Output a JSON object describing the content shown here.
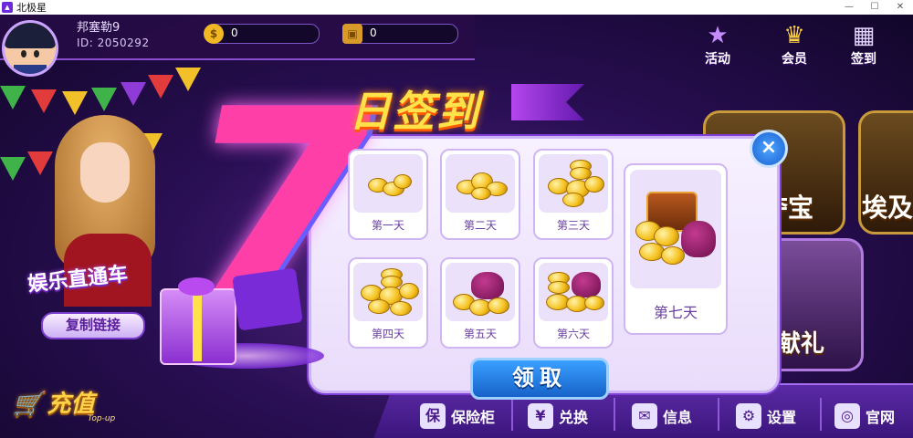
{
  "window": {
    "title": "北极星",
    "app_icon": "app-logo-icon",
    "controls": [
      "minimize-icon",
      "maximize-icon",
      "close-icon"
    ]
  },
  "user": {
    "name": "邦塞勒9",
    "id_text": "ID: 2050292",
    "gold": "0",
    "tickets": "0"
  },
  "top_actions": [
    {
      "label": "活动",
      "icon": "star-trumpet-icon"
    },
    {
      "label": "会员",
      "icon": "crown-gem-icon"
    },
    {
      "label": "签到",
      "icon": "calendar-sign-icon"
    }
  ],
  "promo": {
    "title": "娱乐直通车",
    "copy_button": "复制链接"
  },
  "recharge": {
    "label": "充值",
    "sub": "Top-up"
  },
  "background_text": {
    "tile1": "夺宝",
    "tile2": "埃及",
    "tile3": "神献礼"
  },
  "modal": {
    "title": "日签到",
    "big_number": "7",
    "days": [
      "第一天",
      "第二天",
      "第三天",
      "第四天",
      "第五天",
      "第六天"
    ],
    "day7": "第七天",
    "claim_button": "领取",
    "close": "×"
  },
  "bottom_nav": [
    {
      "label": "保险柜",
      "icon": "safe-icon",
      "glyph": "保"
    },
    {
      "label": "兑换",
      "icon": "exchange-ticket-icon",
      "glyph": "¥"
    },
    {
      "label": "信息",
      "icon": "mail-icon",
      "glyph": "✉"
    },
    {
      "label": "设置",
      "icon": "gear-icon",
      "glyph": "⚙"
    },
    {
      "label": "官网",
      "icon": "website-icon",
      "glyph": "◎"
    }
  ],
  "colors": {
    "accent": "#7b3dcf",
    "gold": "#f5c21f",
    "claim_blue": "#1762c9"
  }
}
